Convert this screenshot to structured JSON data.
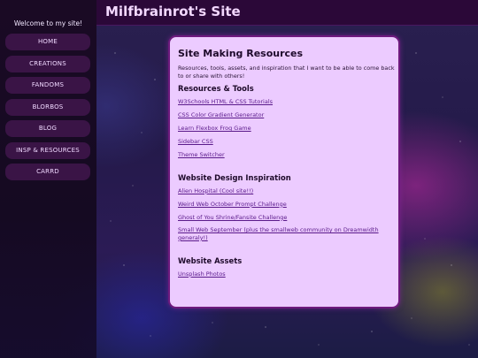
{
  "header": {
    "site_title": "Milfbrainrot's Site"
  },
  "sidebar": {
    "welcome": "Welcome to my site!",
    "items": [
      {
        "label": "HOME"
      },
      {
        "label": "CREATIONS"
      },
      {
        "label": "FANDOMS"
      },
      {
        "label": "BLORBOS"
      },
      {
        "label": "BLOG"
      },
      {
        "label": "INSP & RESOURCES"
      },
      {
        "label": "CARRD"
      }
    ]
  },
  "main": {
    "title": "Site Making Resources",
    "intro": "Resources, tools, assets, and inspiration that I want to be able to come back to or share with others!",
    "sections": [
      {
        "heading": "Resources & Tools",
        "links": [
          "W3Schools HTML & CSS Tutorials",
          "CSS Color Gradient Generator",
          "Learn Flexbox Frog Game",
          "Sidebar CSS",
          "Theme Switcher"
        ]
      },
      {
        "heading": "Website Design Inspiration",
        "links": [
          "Alien Hospital (Cool site!!)",
          "Weird Web October Prompt Challenge",
          "Ghost of You Shrine/Fansite Challenge",
          "Small Web September (plus the smallweb community on Dreamwidth generaly!)"
        ]
      },
      {
        "heading": "Website Assets",
        "links": [
          "Unsplash Photos"
        ]
      }
    ]
  },
  "colors": {
    "header_bg": "#2b0838",
    "card_bg": "#eccbff",
    "card_border": "#6e1a7e",
    "nav_item_bg": "#3a1446",
    "link": "#5a1a8a"
  }
}
